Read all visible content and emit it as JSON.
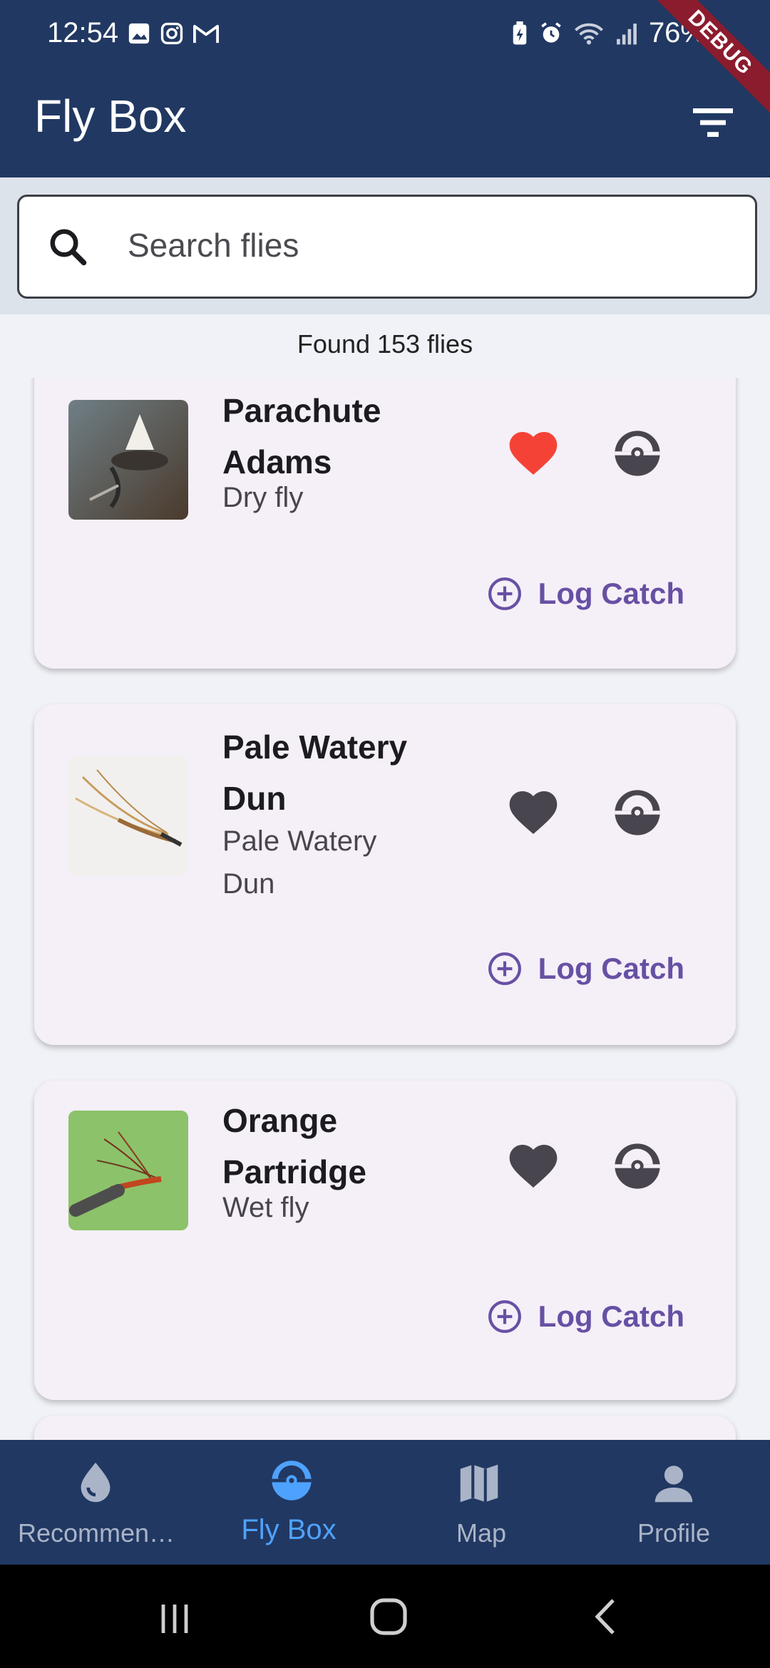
{
  "status_bar": {
    "time": "12:54",
    "battery": "76%"
  },
  "app_bar": {
    "title": "Fly Box",
    "debug_label": "DEBUG"
  },
  "search": {
    "placeholder": "Search flies"
  },
  "results": {
    "found_text": "Found 153 flies"
  },
  "flies": [
    {
      "name": "Parachute Adams",
      "type": "Dry fly",
      "favorite": true,
      "action_label": "Log Catch"
    },
    {
      "name": "Pale Watery Dun",
      "type": "Pale Watery Dun",
      "favorite": false,
      "action_label": "Log Catch"
    },
    {
      "name": "Orange Partridge",
      "type": "Wet fly",
      "favorite": false,
      "action_label": "Log Catch"
    }
  ],
  "bottom_nav": {
    "items": [
      {
        "label": "Recommen…",
        "icon": "water-drop-icon"
      },
      {
        "label": "Fly Box",
        "icon": "fly-box-icon",
        "active": true
      },
      {
        "label": "Map",
        "icon": "map-icon"
      },
      {
        "label": "Profile",
        "icon": "person-icon"
      }
    ]
  },
  "colors": {
    "primary": "#213862",
    "accent": "#6750a4",
    "favorite": "#f44336",
    "nav_active": "#4ea2ff"
  }
}
